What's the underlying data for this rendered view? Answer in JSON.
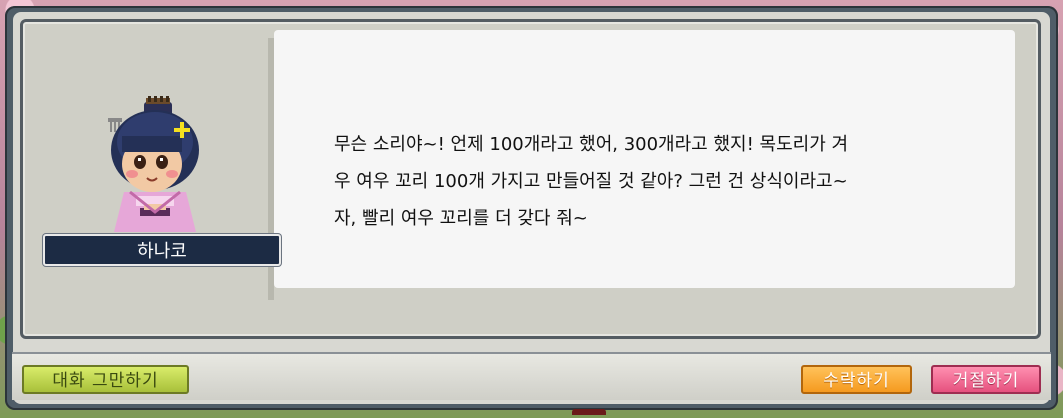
{
  "npc": {
    "name": "하나코",
    "portrait_icon": "npc-portrait-hanako"
  },
  "dialog": {
    "text": "무슨 소리야~! 언제 100개라고 했어, 300개라고 했지! 목도리가 겨\n우 여우 꼬리 100개 가지고 만들어질 것 같아? 그런 건 상식이라고~\n자, 빨리 여우 꼬리를 더 갖다 줘~"
  },
  "buttons": {
    "end_chat": "대화 그만하기",
    "accept": "수락하기",
    "decline": "거절하기"
  },
  "colors": {
    "end_chat": "#c4d84e",
    "accept": "#f7a52d",
    "decline": "#f06a92",
    "name_plate": "#1c2b44"
  }
}
